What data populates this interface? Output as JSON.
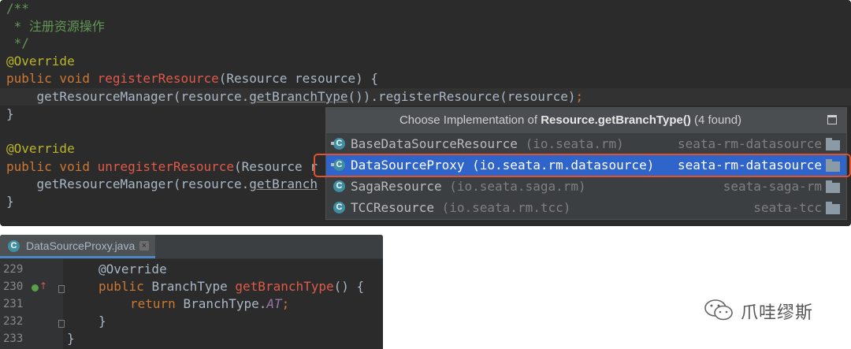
{
  "top_code": {
    "line1": "/**",
    "line2": " * 注册资源操作",
    "line3": " */",
    "anno1": "@Override",
    "l5_kw": "public void ",
    "l5_fn": "registerResource",
    "l5_rest": "(Resource resource) {",
    "l6_a": "    getResourceManager(resource.",
    "l6_b": "getBranchType",
    "l6_c": "()).registerResource(resource)",
    "l6_semi": ";",
    "l7": "}",
    "anno2": "@Override",
    "l10_kw": "public void ",
    "l10_fn": "unregisterResource",
    "l10_rest": "(Resource r",
    "l11_a": "    getResourceManager(resource.",
    "l11_b": "getBranch",
    "l12": "}"
  },
  "popup": {
    "title_prefix": "Choose Implementation of ",
    "title_bold": "Resource.getBranchType()",
    "title_suffix": " (4 found)",
    "items": [
      {
        "icon": "C",
        "name": "BaseDataSourceResource",
        "pkg": "(io.seata.rm)",
        "module": "seata-rm-datasource"
      },
      {
        "icon": "C",
        "name": "DataSourceProxy",
        "pkg": "(io.seata.rm.datasource)",
        "module": "seata-rm-datasource"
      },
      {
        "icon": "C",
        "name": "SagaResource",
        "pkg": "(io.seata.saga.rm)",
        "module": "seata-saga-rm"
      },
      {
        "icon": "C",
        "name": "TCCResource",
        "pkg": "(io.seata.rm.tcc)",
        "module": "seata-tcc"
      }
    ]
  },
  "bottom_editor": {
    "tab_icon": "C",
    "tab_label": "DataSourceProxy.java",
    "tab_close": "×",
    "line_numbers": [
      "229",
      "230",
      "231",
      "232",
      "233"
    ],
    "anno": "@Override",
    "l2_kw": "public ",
    "l2_type": "BranchType ",
    "l2_fn": "getBranchType",
    "l2_rest": "() {",
    "l3_kw": "return ",
    "l3_a": "BranchType.",
    "l3_b": "AT",
    "l3_semi": ";",
    "l4": "}",
    "l5": "}"
  },
  "watermark": {
    "text": "爪哇缪斯",
    "icon": "wechat-icon"
  },
  "colors": {
    "editor_bg": "#2b2b2b",
    "selection": "#2f65ca",
    "highlight_border": "#e0532d",
    "keyword": "#cc7832",
    "annotation": "#bbb529",
    "comment": "#629755",
    "method_red": "#e05a4a"
  }
}
